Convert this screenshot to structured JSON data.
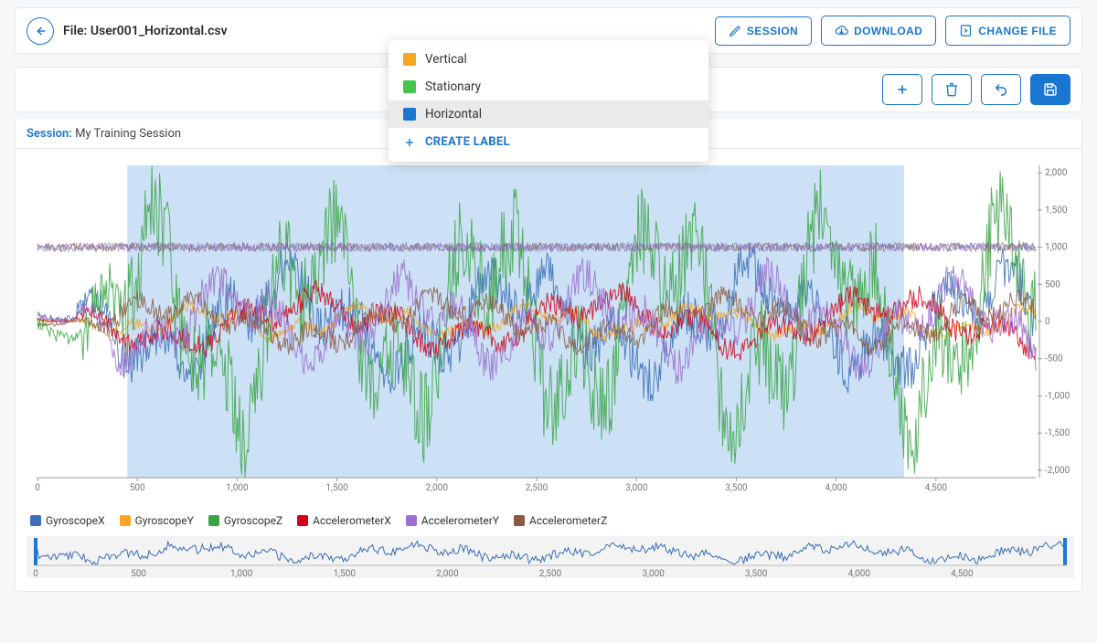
{
  "header": {
    "file_prefix": "File:",
    "filename": "User001_Horizontal.csv",
    "buttons": {
      "session": "SESSION",
      "download": "DOWNLOAD",
      "change_file": "CHANGE FILE"
    }
  },
  "dropdown": {
    "items": [
      {
        "label": "Vertical",
        "color": "#f6a623"
      },
      {
        "label": "Stationary",
        "color": "#43c64a"
      },
      {
        "label": "Horizontal",
        "color": "#1976d2"
      }
    ],
    "hovered_index": 2,
    "create_label": "CREATE LABEL"
  },
  "session": {
    "key": "Session:",
    "value": "My Training Session"
  },
  "legend": [
    {
      "label": "GyroscopeX",
      "color": "#3b6fb6"
    },
    {
      "label": "GyroscopeY",
      "color": "#f6a623"
    },
    {
      "label": "GyroscopeZ",
      "color": "#3aa545"
    },
    {
      "label": "AccelerometerX",
      "color": "#d0021b"
    },
    {
      "label": "AccelerometerY",
      "color": "#9b6fcf"
    },
    {
      "label": "AccelerometerZ",
      "color": "#8b5a44"
    }
  ],
  "chart_data": {
    "type": "line",
    "xlabel": "",
    "ylabel": "",
    "xlim": [
      0,
      5000
    ],
    "ylim": [
      -2100,
      2100
    ],
    "y_ticks": [
      -2000,
      -1500,
      -1000,
      -500,
      0,
      500,
      1000,
      1500,
      2000
    ],
    "x_ticks": [
      0,
      500,
      1000,
      1500,
      2000,
      2500,
      3000,
      3500,
      4000,
      4500
    ],
    "selection": [
      450,
      4340
    ],
    "baseline_y": 1000,
    "series": [
      {
        "name": "GyroscopeX",
        "color": "#3b6fb6",
        "amp": 900,
        "offset": 0
      },
      {
        "name": "GyroscopeY",
        "color": "#f6a623",
        "amp": 250,
        "offset": 0
      },
      {
        "name": "GyroscopeZ",
        "color": "#3aa545",
        "amp": 1800,
        "offset": 0
      },
      {
        "name": "AccelerometerX",
        "color": "#d0021b",
        "amp": 450,
        "offset": 0
      },
      {
        "name": "AccelerometerY",
        "color": "#9b6fcf",
        "amp": 700,
        "offset": 0
      },
      {
        "name": "AccelerometerZ",
        "color": "#8b5a44",
        "amp": 400,
        "offset": 0
      }
    ],
    "mini": {
      "xlim": [
        0,
        5000
      ],
      "x_ticks": [
        0,
        500,
        1000,
        1500,
        2000,
        2500,
        3000,
        3500,
        4000,
        4500
      ]
    }
  }
}
